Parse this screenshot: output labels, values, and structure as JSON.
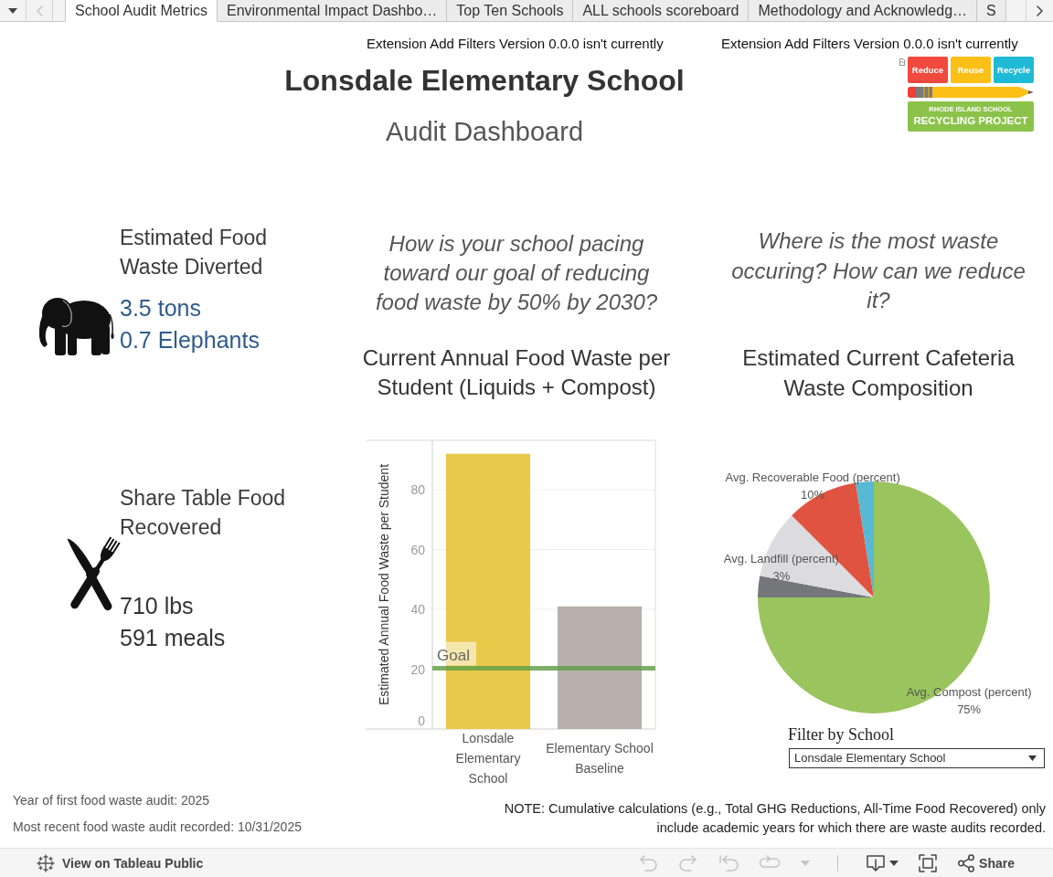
{
  "tab_bar": {
    "scroll_buttons": [
      {
        "kind": "prev",
        "disabled": true
      },
      {
        "kind": "next",
        "disabled": false
      }
    ],
    "tabs": [
      {
        "label": "School Audit Metrics",
        "selected": true
      },
      {
        "label": "Environmental Impact Dashbo…",
        "selected": false
      },
      {
        "label": "Top Ten Schools",
        "selected": false
      },
      {
        "label": "ALL schools scoreboard",
        "selected": false
      },
      {
        "label": "Methodology and Acknowledg…",
        "selected": false
      },
      {
        "label": "S",
        "selected": false
      }
    ]
  },
  "header": {
    "extension_messages": [
      "Extension Add Filters Version 0.0.0 isn't currently",
      "Extension Add Filters Version 0.0.0 isn't currently"
    ],
    "title": "Lonsdale Elementary School",
    "subtitle": "Audit Dashboard",
    "logo": {
      "tiles": [
        {
          "label": "Reduce",
          "color": "#f0493d"
        },
        {
          "label": "Reuse",
          "color": "#fcbf17"
        },
        {
          "label": "Recycle",
          "color": "#1fbad6"
        }
      ],
      "banner_lines": [
        "RHODE ISLAND SCHOOL",
        "RECYCLING PROJECT"
      ]
    }
  },
  "metrics": [
    {
      "title": "Estimated Food Waste Diverted",
      "values": [
        "3.5 tons",
        "0.7 Elephants"
      ],
      "color": "#2e5b8b"
    },
    {
      "title": "Share Table Food Recovered",
      "values": [
        "710 lbs",
        "591 meals"
      ],
      "color": "#333333"
    }
  ],
  "panels": [
    {
      "question": "How is your school pacing toward our goal of reducing food waste by 50% by 2030?",
      "chart_title": "Current Annual Food Waste per Student (Liquids + Compost)",
      "chart_data": {
        "type": "bar",
        "ylabel": "Estimated Annual Food Waste per Student",
        "categories": [
          "Lonsdale Elementary School",
          "Elementary School Baseline"
        ],
        "values": [
          92,
          41
        ],
        "colors": [
          "#e9c84a",
          "#b9b0ab"
        ],
        "ylim": [
          0,
          96.5
        ],
        "yticks": [
          0,
          20,
          40,
          60,
          80
        ],
        "grid": true,
        "ref_lines": [
          {
            "axis": "y",
            "value": 20.3,
            "label": "Goal"
          }
        ]
      }
    },
    {
      "question": "Where is the most waste occuring? How can we reduce it?",
      "chart_title": "Estimated Current Cafeteria Waste Composition",
      "chart_data": {
        "type": "pie",
        "categories": [
          "Avg. Compost (percent)",
          "Avg. Landfill (percent)",
          null,
          "Avg. Recoverable Food (percent)",
          null
        ],
        "values": [
          75,
          3,
          9.5,
          10,
          2.5
        ],
        "value_labels": [
          "75%",
          "3%",
          null,
          "10%",
          null
        ],
        "colors": [
          "#9ac45d",
          "#75767a",
          "#dcdce0",
          "#e05340",
          "#57b9d3"
        ]
      },
      "filter": {
        "label": "Filter by School",
        "value": "Lonsdale Elementary School"
      }
    }
  ],
  "footer": {
    "audit_info": [
      "Year of first food waste audit: 2025",
      "Most recent food waste audit recorded: 10/31/2025"
    ],
    "note": "NOTE: Cumulative calculations (e.g., Total GHG Reductions, All-Time Food Recovered) only include academic years for which there are waste audits recorded."
  },
  "toolbar": {
    "link": "View on Tableau Public",
    "buttons": [
      {
        "kind": "undo",
        "disabled": true
      },
      {
        "kind": "redo",
        "disabled": true
      },
      {
        "kind": "revert",
        "disabled": true
      },
      {
        "kind": "refresh",
        "disabled": true
      },
      {
        "kind": "dropdown",
        "disabled": true
      },
      {
        "kind": "download",
        "disabled": false
      },
      {
        "kind": "fullscreen",
        "disabled": false
      },
      {
        "kind": "share",
        "label": "Share",
        "disabled": false
      }
    ]
  }
}
